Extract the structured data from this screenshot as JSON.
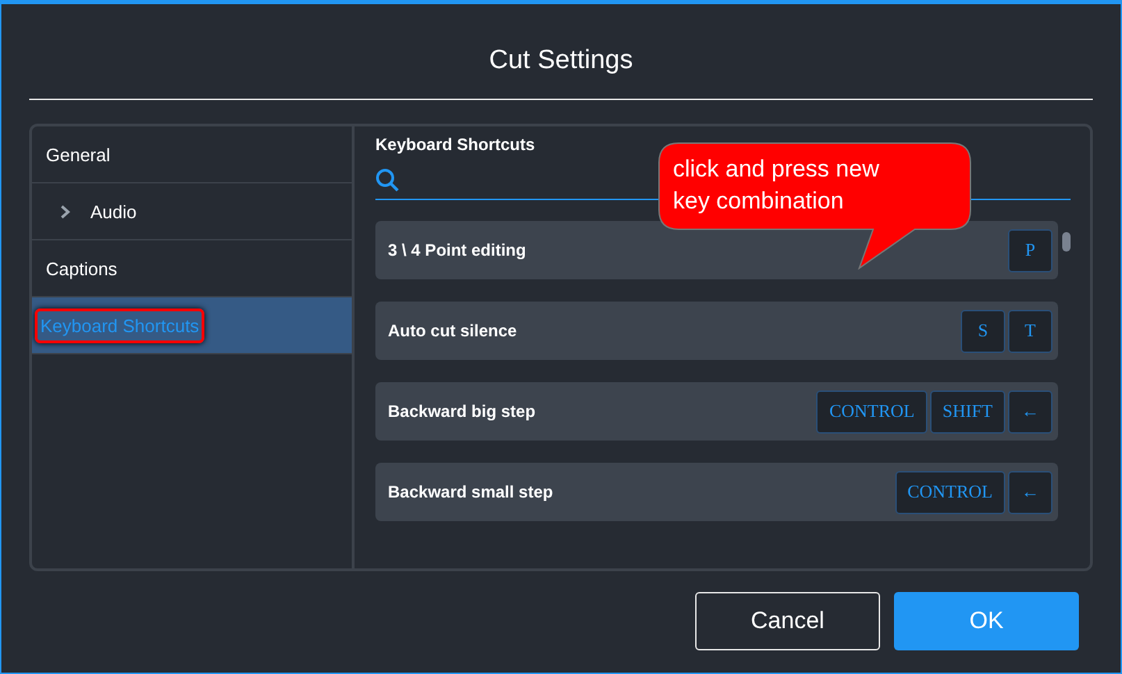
{
  "window": {
    "title": "Cut Settings"
  },
  "sidebar": {
    "items": [
      {
        "label": "General",
        "selected": false,
        "highlighted": false,
        "children": [
          {
            "label": "Audio",
            "selected": false,
            "highlighted": false,
            "expanded": false
          }
        ]
      },
      {
        "label": "Captions",
        "selected": false,
        "highlighted": false
      },
      {
        "label": "Keyboard Shortcuts",
        "selected": true,
        "highlighted": true
      }
    ]
  },
  "section": {
    "title": "Keyboard Shortcuts"
  },
  "shortcuts": [
    {
      "name": "3 \\ 4 Point editing",
      "keys": [
        "P"
      ]
    },
    {
      "name": "Auto cut silence",
      "keys": [
        "S",
        "T"
      ]
    },
    {
      "name": "Backward big step",
      "keys": [
        "CONTROL",
        "SHIFT",
        "←"
      ]
    },
    {
      "name": "Backward small step",
      "keys": [
        "CONTROL",
        "←"
      ]
    }
  ],
  "callout": {
    "text": "click and press new key combination"
  },
  "buttons": [
    {
      "label": "Cancel",
      "kind": "secondary"
    },
    {
      "label": "OK",
      "kind": "primary"
    }
  ]
}
